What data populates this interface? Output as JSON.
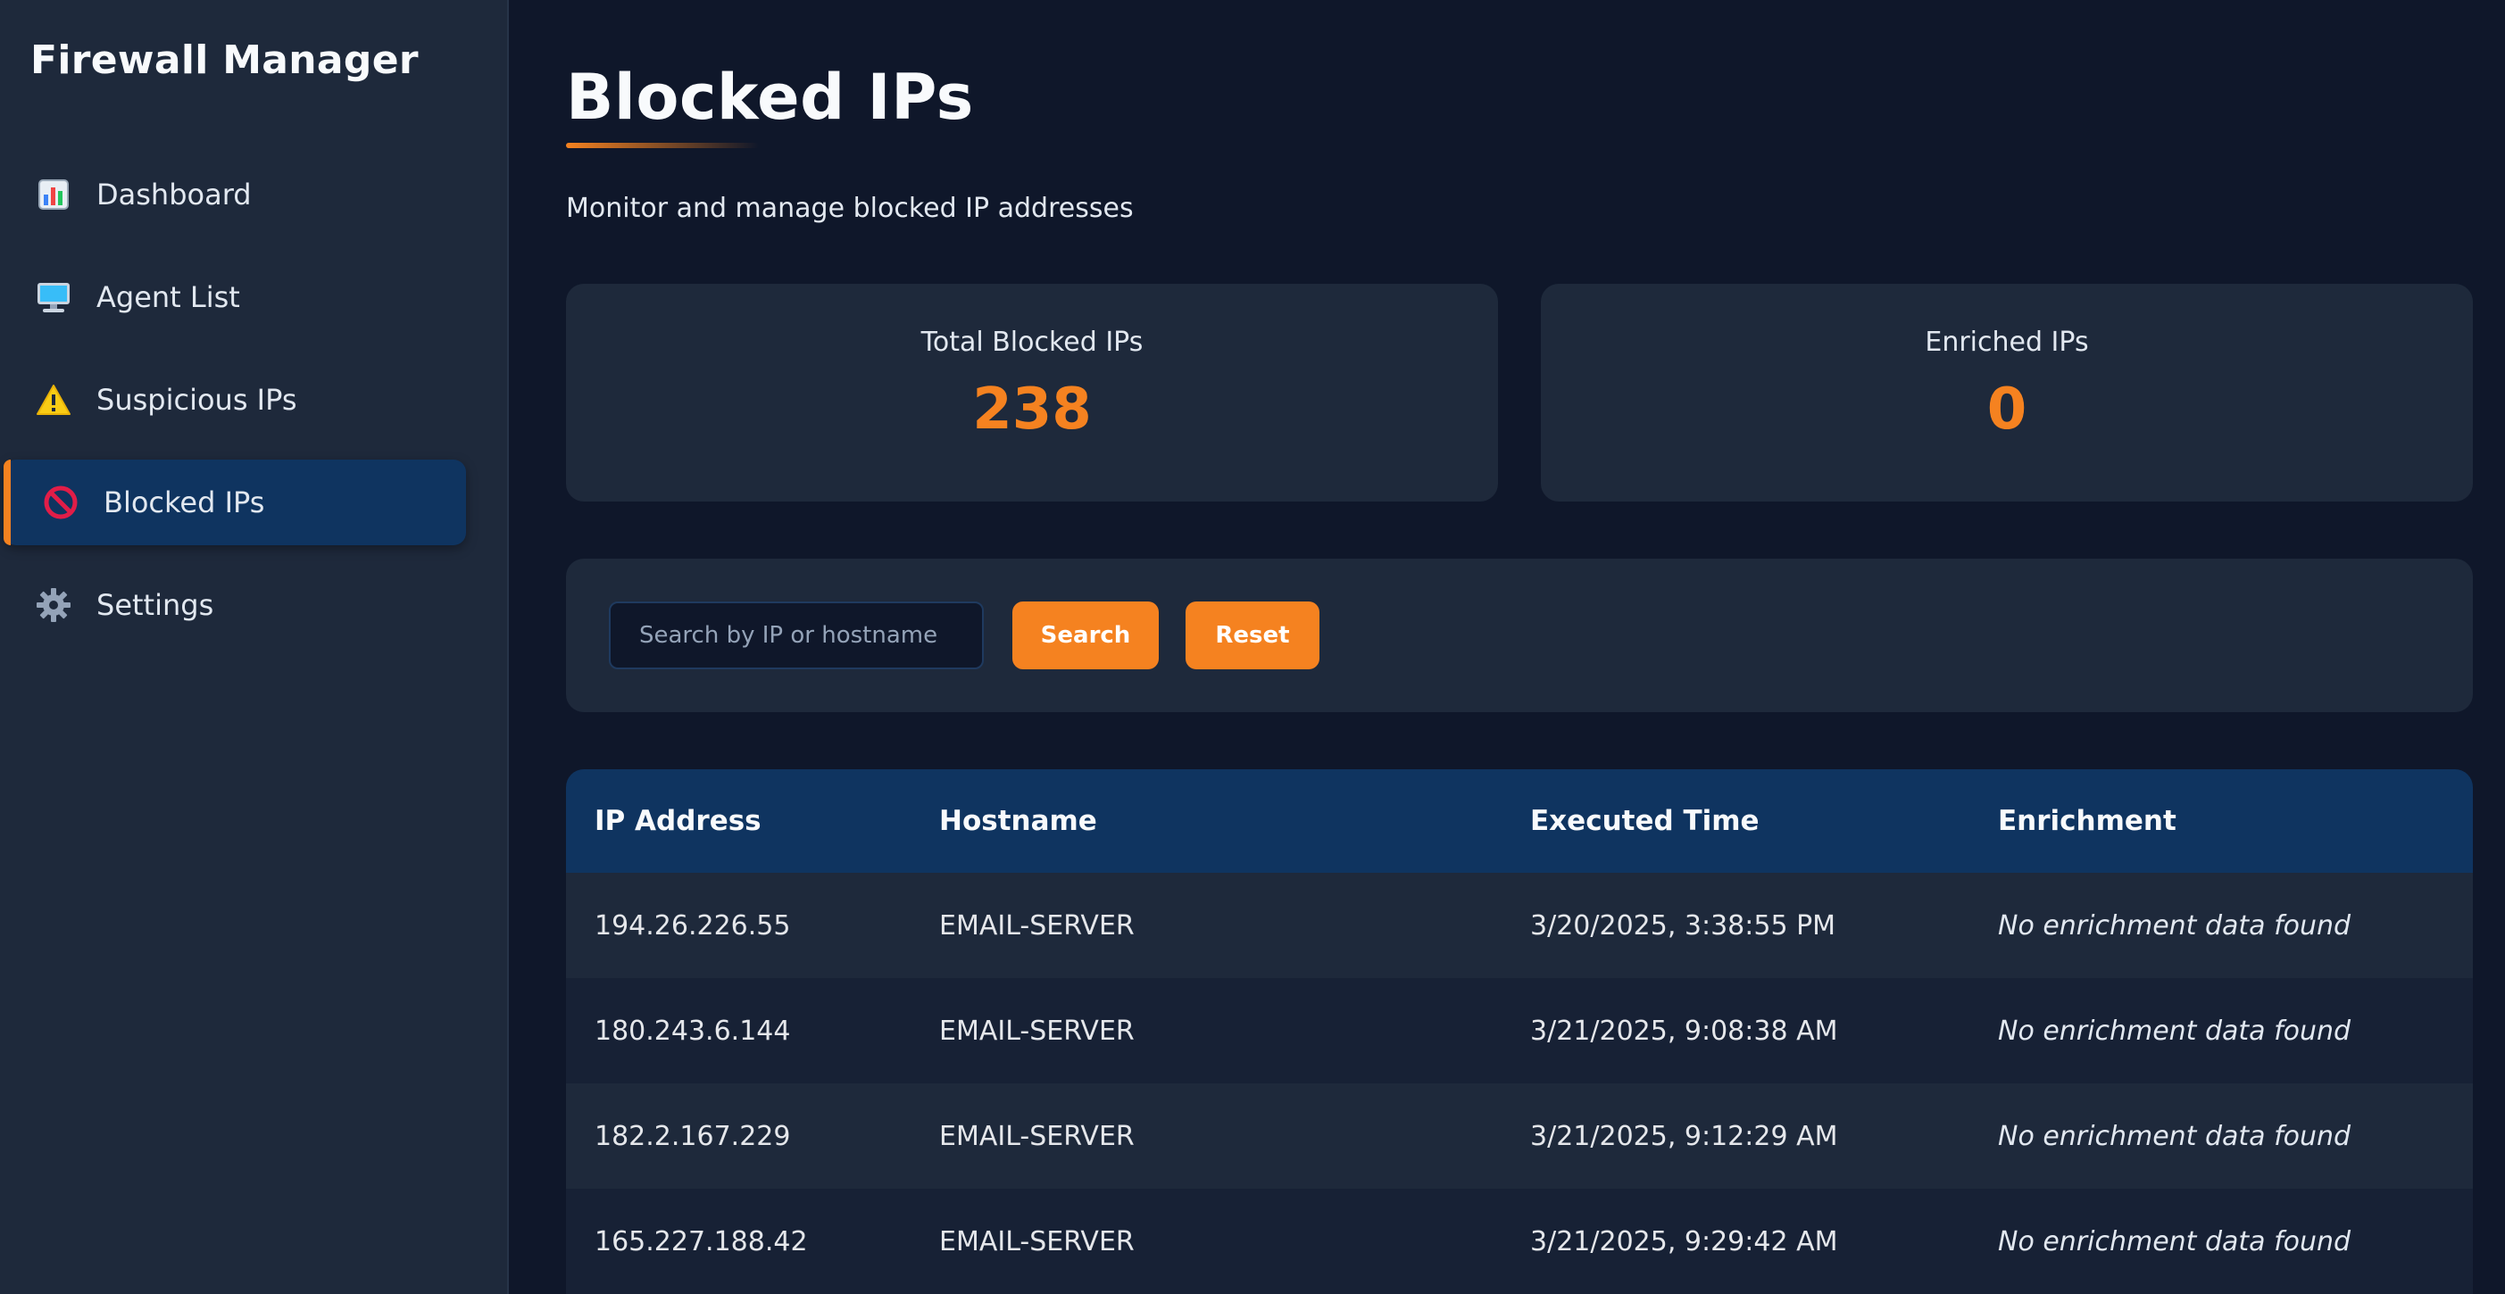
{
  "sidebar": {
    "brand": "Firewall Manager",
    "items": [
      {
        "label": "Dashboard",
        "icon": "bar-chart-icon"
      },
      {
        "label": "Agent List",
        "icon": "monitor-icon"
      },
      {
        "label": "Suspicious IPs",
        "icon": "warning-icon"
      },
      {
        "label": "Blocked IPs",
        "icon": "prohibited-icon",
        "active": true
      },
      {
        "label": "Settings",
        "icon": "gear-icon"
      }
    ]
  },
  "header": {
    "title": "Blocked IPs",
    "subtitle": "Monitor and manage blocked IP addresses"
  },
  "stats": {
    "total": {
      "label": "Total Blocked IPs",
      "value": "238"
    },
    "enriched": {
      "label": "Enriched IPs",
      "value": "0"
    }
  },
  "search": {
    "placeholder": "Search by IP or hostname",
    "value": "",
    "search_label": "Search",
    "reset_label": "Reset"
  },
  "table": {
    "columns": [
      "IP Address",
      "Hostname",
      "Executed Time",
      "Enrichment"
    ],
    "rows": [
      [
        "194.26.226.55",
        "EMAIL-SERVER",
        "3/20/2025, 3:38:55 PM",
        "No enrichment data found"
      ],
      [
        "180.243.6.144",
        "EMAIL-SERVER",
        "3/21/2025, 9:08:38 AM",
        "No enrichment data found"
      ],
      [
        "182.2.167.229",
        "EMAIL-SERVER",
        "3/21/2025, 9:12:29 AM",
        "No enrichment data found"
      ],
      [
        "165.227.188.42",
        "EMAIL-SERVER",
        "3/21/2025, 9:29:42 AM",
        "No enrichment data found"
      ]
    ]
  },
  "colors": {
    "accent": "#f58220",
    "sidebar_bg": "#1e293b",
    "page_bg": "#0f172a",
    "header_bg": "#0f3460"
  }
}
